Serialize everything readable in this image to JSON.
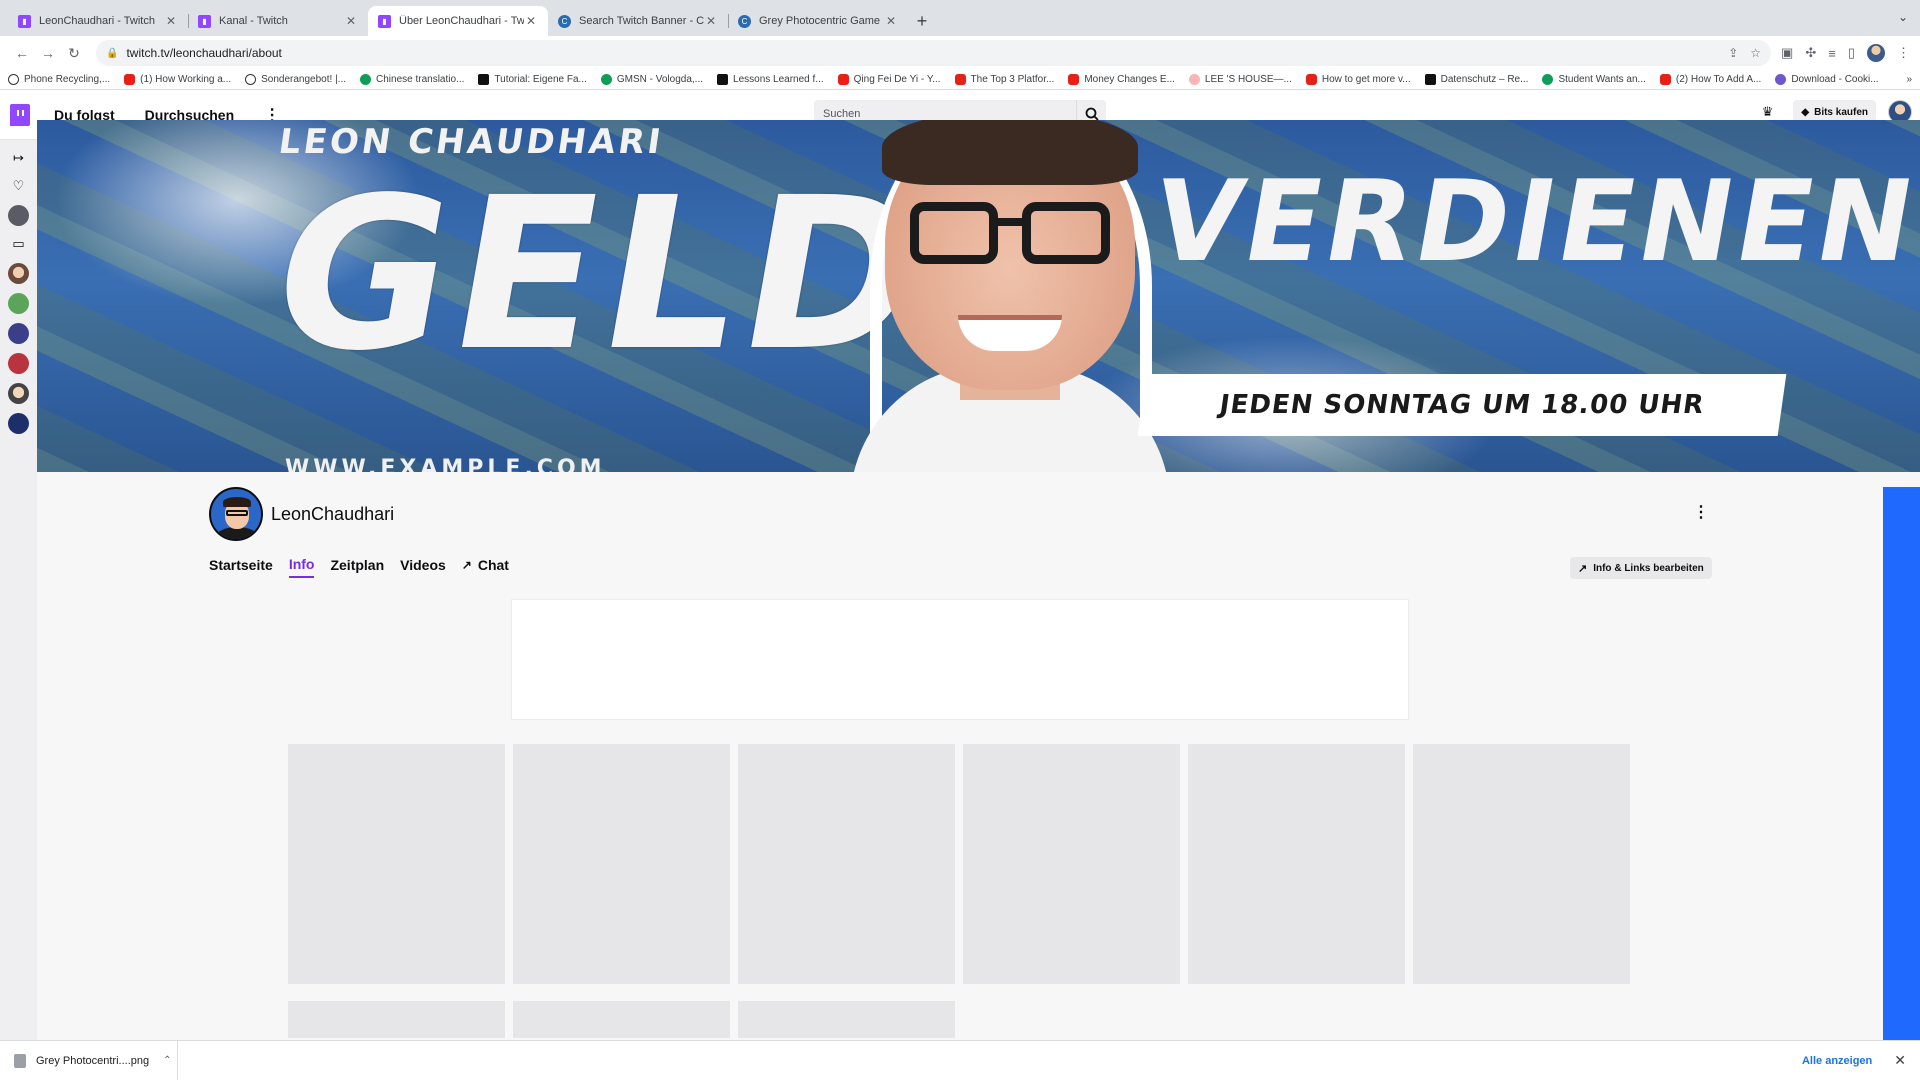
{
  "browser": {
    "tabs": [
      {
        "title": "LeonChaudhari - Twitch",
        "favicon": "twitch-icon",
        "active": false
      },
      {
        "title": "Kanal - Twitch",
        "favicon": "twitch-icon",
        "active": false
      },
      {
        "title": "Über LeonChaudhari - Twitch",
        "favicon": "twitch-icon",
        "active": true
      },
      {
        "title": "Search Twitch Banner - Canva",
        "favicon": "canva-icon",
        "active": false
      },
      {
        "title": "Grey Photocentric Game Night",
        "favicon": "canva-icon",
        "active": false
      }
    ],
    "url": "twitch.tv/leonchaudhari/about",
    "bookmarks": [
      {
        "label": "Phone Recycling,...",
        "icon": "circle"
      },
      {
        "label": "(1) How Working a...",
        "icon": "yt"
      },
      {
        "label": "Sonderangebot! |...",
        "icon": "o"
      },
      {
        "label": "Chinese translatio...",
        "icon": "g"
      },
      {
        "label": "Tutorial: Eigene Fa...",
        "icon": "hash"
      },
      {
        "label": "GMSN - Vologda,...",
        "icon": "g"
      },
      {
        "label": "Lessons Learned f...",
        "icon": "er"
      },
      {
        "label": "Qing Fei De Yi - Y...",
        "icon": "yt"
      },
      {
        "label": "The Top 3 Platfor...",
        "icon": "yt"
      },
      {
        "label": "Money Changes E...",
        "icon": "yt"
      },
      {
        "label": "LEE 'S HOUSE—...",
        "icon": "r"
      },
      {
        "label": "How to get more v...",
        "icon": "yt"
      },
      {
        "label": "Datenschutz – Re...",
        "icon": "k"
      },
      {
        "label": "Student Wants an...",
        "icon": "g"
      },
      {
        "label": "(2) How To Add A...",
        "icon": "yt"
      },
      {
        "label": "Download - Cooki...",
        "icon": "p"
      }
    ],
    "more_bookmarks": "»"
  },
  "twitch": {
    "nav_following": "Du folgst",
    "nav_browse": "Durchsuchen",
    "more_icon": "⋮",
    "search_placeholder": "Suchen",
    "bits_label": "Bits kaufen"
  },
  "banner": {
    "name": "LEON CHAUDHARI",
    "word1": "GELD",
    "word2": "VERDIENEN",
    "schedule": "JEDEN SONNTAG UM 18.00 UHR",
    "url": "WWW.EXAMPLE.COM"
  },
  "channel": {
    "name": "LeonChaudhari",
    "tabs": [
      {
        "label": "Startseite",
        "active": false
      },
      {
        "label": "Info",
        "active": true
      },
      {
        "label": "Zeitplan",
        "active": false
      },
      {
        "label": "Videos",
        "active": false
      },
      {
        "label": "Chat",
        "active": false,
        "external": true
      }
    ],
    "edit_button": "Info & Links bearbeiten"
  },
  "downloads": {
    "file": "Grey Photocentri....png",
    "show_all": "Alle anzeigen"
  },
  "colors": {
    "twitch_purple": "#9146ff",
    "active_tab": "#772ce8",
    "side_blue": "#1f69ff"
  }
}
